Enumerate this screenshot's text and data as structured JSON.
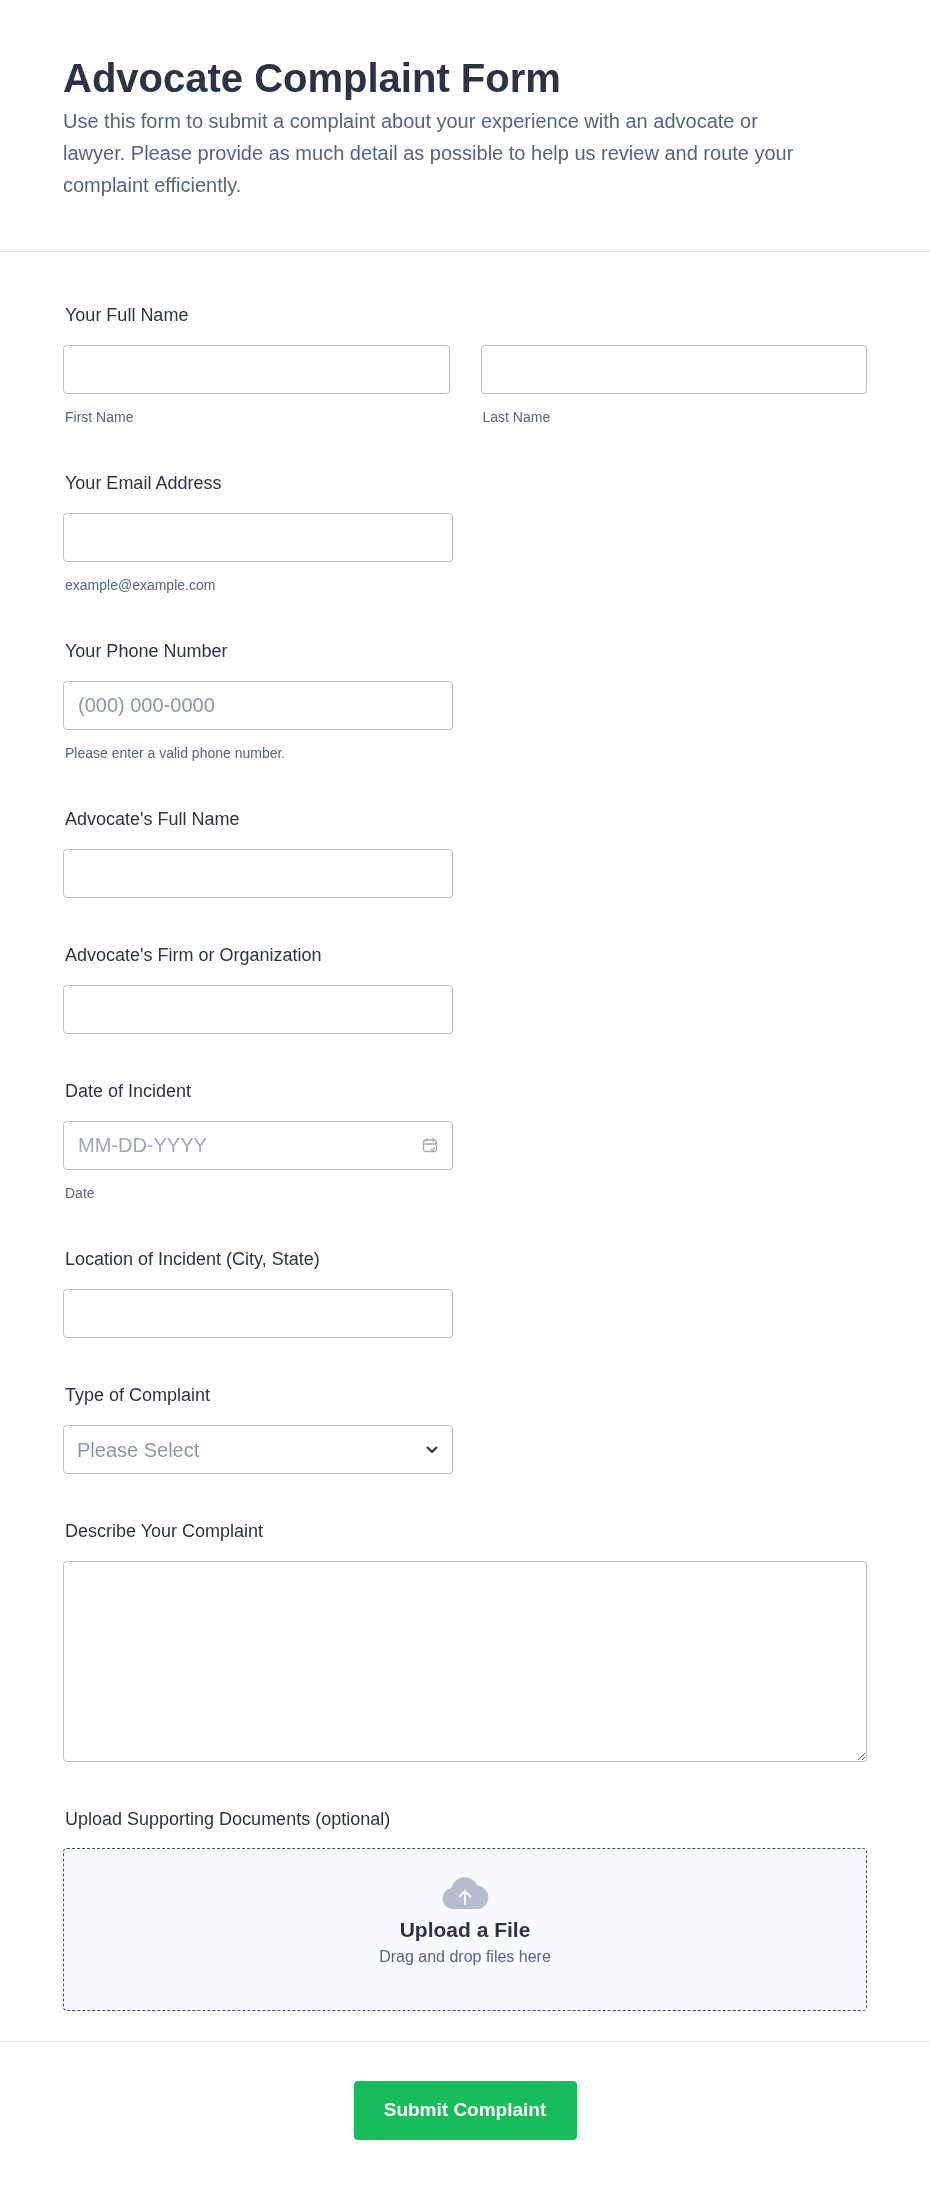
{
  "header": {
    "title": "Advocate Complaint Form",
    "description": "Use this form to submit a complaint about your experience with an advocate or lawyer. Please provide as much detail as possible to help us review and route your complaint efficiently."
  },
  "fields": [
    {
      "kind": "name",
      "label": "Your Full Name",
      "parts": [
        {
          "sublabel": "First Name"
        },
        {
          "sublabel": "Last Name"
        }
      ]
    },
    {
      "kind": "text",
      "label": "Your Email Address",
      "sublabel": "example@example.com"
    },
    {
      "kind": "text",
      "label": "Your Phone Number",
      "placeholder": "(000) 000-0000",
      "sublabel": "Please enter a valid phone number."
    },
    {
      "kind": "text",
      "label": "Advocate's Full Name"
    },
    {
      "kind": "text",
      "label": "Advocate's Firm or Organization"
    },
    {
      "kind": "date",
      "label": "Date of Incident",
      "placeholder": "MM-DD-YYYY",
      "sublabel": "Date"
    },
    {
      "kind": "text",
      "label": "Location of Incident (City, State)"
    },
    {
      "kind": "select",
      "label": "Type of Complaint",
      "placeholder": "Please Select"
    },
    {
      "kind": "textarea",
      "label": "Describe Your Complaint"
    },
    {
      "kind": "upload",
      "label": "Upload Supporting Documents (optional)",
      "title": "Upload a File",
      "hint": "Drag and drop files here"
    }
  ],
  "submit_button": {
    "label": "Submit Complaint"
  }
}
